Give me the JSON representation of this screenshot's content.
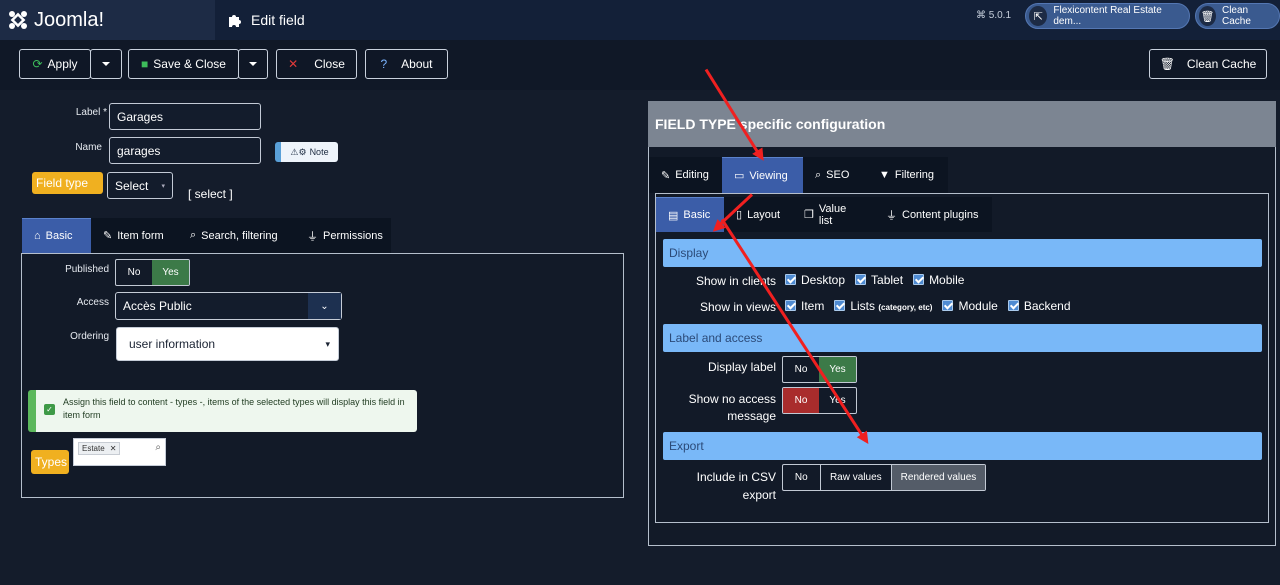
{
  "header": {
    "logo": "Joomla!",
    "page_title": "Edit field",
    "version": "5.0.1",
    "site_pill": "Flexicontent Real Estate dem...",
    "cache_pill": "Clean Cache"
  },
  "toolbar": {
    "apply": "Apply",
    "save_close": "Save & Close",
    "close": "Close",
    "about": "About",
    "clean_cache": "Clean Cache"
  },
  "form": {
    "label_label": "Label *",
    "label_value": "Garages",
    "name_label": "Name",
    "name_value": "garages",
    "note_label": "Note",
    "field_type_label": "Field type",
    "field_type_value": "Select",
    "field_type_text": "[ select ]"
  },
  "left_tabs": [
    "Basic",
    "Item form",
    "Search, filtering",
    "Permissions"
  ],
  "basic": {
    "published_label": "Published",
    "published_no": "No",
    "published_yes": "Yes",
    "access_label": "Access",
    "access_value": "Accès Public",
    "ordering_label": "Ordering",
    "ordering_value": "user information",
    "assign_text": "Assign this field to content - types -, items of the selected types will display this field in item form",
    "types_label": "Types",
    "types_tag": "Estate"
  },
  "right": {
    "header": "FIELD TYPE specific configuration",
    "main_tabs": [
      "Editing",
      "Viewing",
      "SEO",
      "Filtering"
    ],
    "sub_tabs": [
      "Basic",
      "Layout",
      "Value list",
      "Content plugins"
    ],
    "sections": {
      "display": "Display",
      "label_access": "Label and access",
      "export": "Export"
    },
    "show_in_clients_label": "Show in clients",
    "clients": [
      "Desktop",
      "Tablet",
      "Mobile"
    ],
    "show_in_views_label": "Show in views",
    "views_item": "Item",
    "views_lists": "Lists",
    "views_lists_note": "(category, etc)",
    "views_module": "Module",
    "views_backend": "Backend",
    "display_label_label": "Display label",
    "display_label_no": "No",
    "display_label_yes": "Yes",
    "no_access_label_1": "Show no access",
    "no_access_label_2": "message",
    "no_access_no": "No",
    "no_access_yes": "Yes",
    "csv_label_1": "Include in CSV",
    "csv_label_2": "export",
    "csv_no": "No",
    "csv_raw": "Raw values",
    "csv_rendered": "Rendered values"
  }
}
